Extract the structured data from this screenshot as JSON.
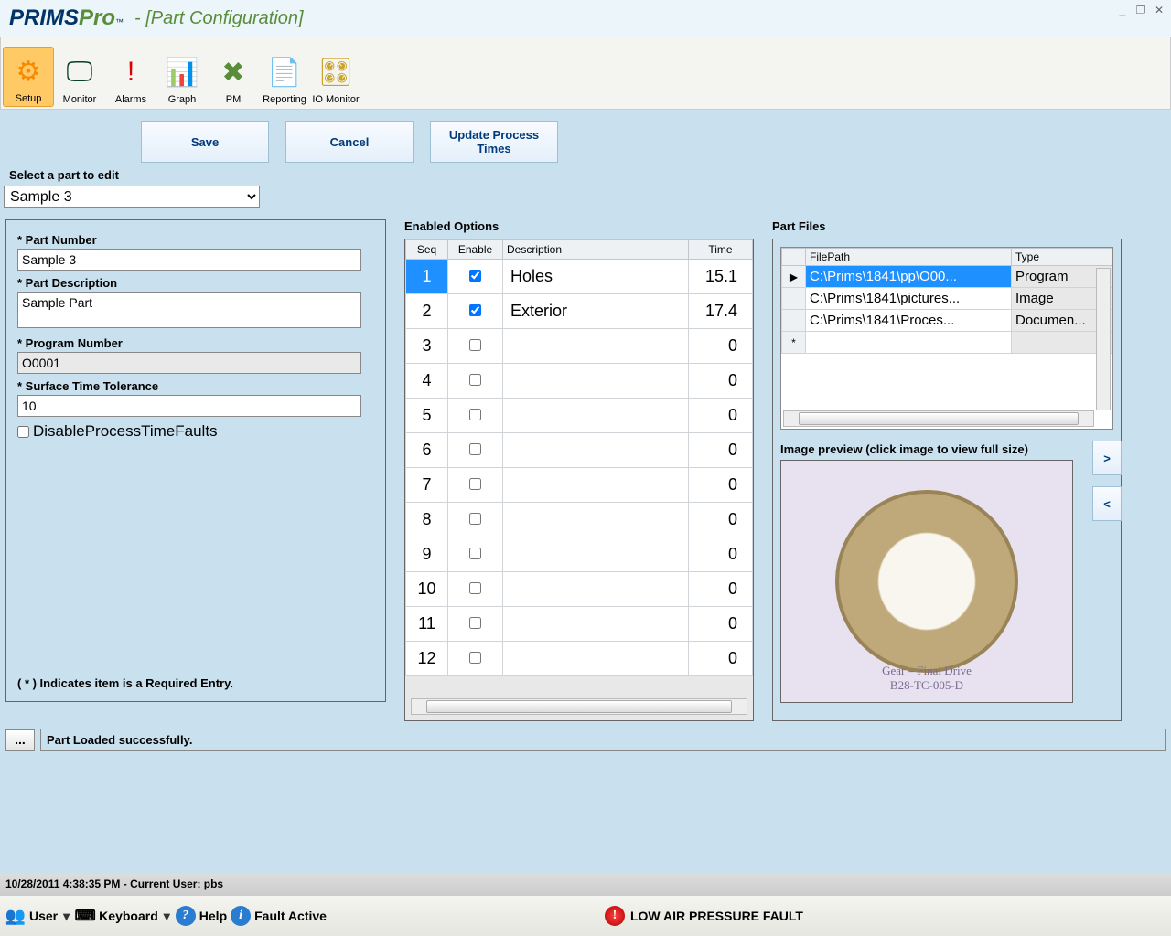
{
  "app": {
    "logo_prims": "PRIMS",
    "logo_pro": "Pro",
    "logo_tm": "™",
    "subtitle": "- [Part Configuration]"
  },
  "win": {
    "min": "_",
    "max": "❐",
    "close": "✕"
  },
  "toolbar": [
    {
      "label": "Setup",
      "glyph": "⚙",
      "color": "#f58a00"
    },
    {
      "label": "Monitor",
      "glyph": "🖵",
      "color": "#0a3d2e"
    },
    {
      "label": "Alarms",
      "glyph": "!",
      "color": "#d00"
    },
    {
      "label": "Graph",
      "glyph": "📊",
      "color": "#d66"
    },
    {
      "label": "PM",
      "glyph": "✖",
      "color": "#5a8d3a"
    },
    {
      "label": "Reporting",
      "glyph": "📄",
      "color": "#2a5fa5"
    },
    {
      "label": "IO Monitor",
      "glyph": "🎛",
      "color": "#c9a227"
    }
  ],
  "actions": {
    "save": "Save",
    "cancel": "Cancel",
    "update": "Update Process Times"
  },
  "select_label": "Select a part to edit",
  "selected_part": "Sample 3",
  "form": {
    "part_number_label": "* Part Number",
    "part_number": "Sample 3",
    "part_desc_label": "* Part Description",
    "part_desc": "Sample Part",
    "program_label": "* Program Number",
    "program": "O0001",
    "tolerance_label": "* Surface Time Tolerance",
    "tolerance": "10",
    "disable_label": "DisableProcessTimeFaults",
    "required_note": "( * ) Indicates item is a Required Entry."
  },
  "options": {
    "title": "Enabled Options",
    "headers": {
      "seq": "Seq",
      "enable": "Enable",
      "desc": "Description",
      "time": "Time"
    },
    "rows": [
      {
        "seq": "1",
        "enabled": true,
        "desc": "Holes",
        "time": "15.1",
        "selected": true
      },
      {
        "seq": "2",
        "enabled": true,
        "desc": "Exterior",
        "time": "17.4"
      },
      {
        "seq": "3",
        "enabled": false,
        "desc": "",
        "time": "0"
      },
      {
        "seq": "4",
        "enabled": false,
        "desc": "",
        "time": "0"
      },
      {
        "seq": "5",
        "enabled": false,
        "desc": "",
        "time": "0"
      },
      {
        "seq": "6",
        "enabled": false,
        "desc": "",
        "time": "0"
      },
      {
        "seq": "7",
        "enabled": false,
        "desc": "",
        "time": "0"
      },
      {
        "seq": "8",
        "enabled": false,
        "desc": "",
        "time": "0"
      },
      {
        "seq": "9",
        "enabled": false,
        "desc": "",
        "time": "0"
      },
      {
        "seq": "10",
        "enabled": false,
        "desc": "",
        "time": "0"
      },
      {
        "seq": "11",
        "enabled": false,
        "desc": "",
        "time": "0"
      },
      {
        "seq": "12",
        "enabled": false,
        "desc": "",
        "time": "0"
      }
    ]
  },
  "files": {
    "title": "Part Files",
    "headers": {
      "path": "FilePath",
      "type": "Type"
    },
    "rows": [
      {
        "rh": "▶",
        "path": "C:\\Prims\\1841\\pp\\O00...",
        "type": "Program",
        "selected": true
      },
      {
        "rh": "",
        "path": "C:\\Prims\\1841\\pictures...",
        "type": "Image"
      },
      {
        "rh": "",
        "path": "C:\\Prims\\1841\\Proces...",
        "type": "Documen..."
      },
      {
        "rh": "*",
        "path": "",
        "type": ""
      }
    ],
    "preview_label": "Image preview (click image to view full size)",
    "preview_caption1": "Gear – Final Drive",
    "preview_caption2": "B28-TC-005-D",
    "nav_next": ">",
    "nav_prev": "<"
  },
  "status": {
    "btn": "...",
    "text": "Part Loaded successfully."
  },
  "timeline": "10/28/2011 4:38:35 PM - Current User:  pbs",
  "footer": {
    "user": "User",
    "keyboard": "Keyboard",
    "help": "Help",
    "fault_active": "Fault Active",
    "alarm": "LOW AIR PRESSURE FAULT"
  }
}
